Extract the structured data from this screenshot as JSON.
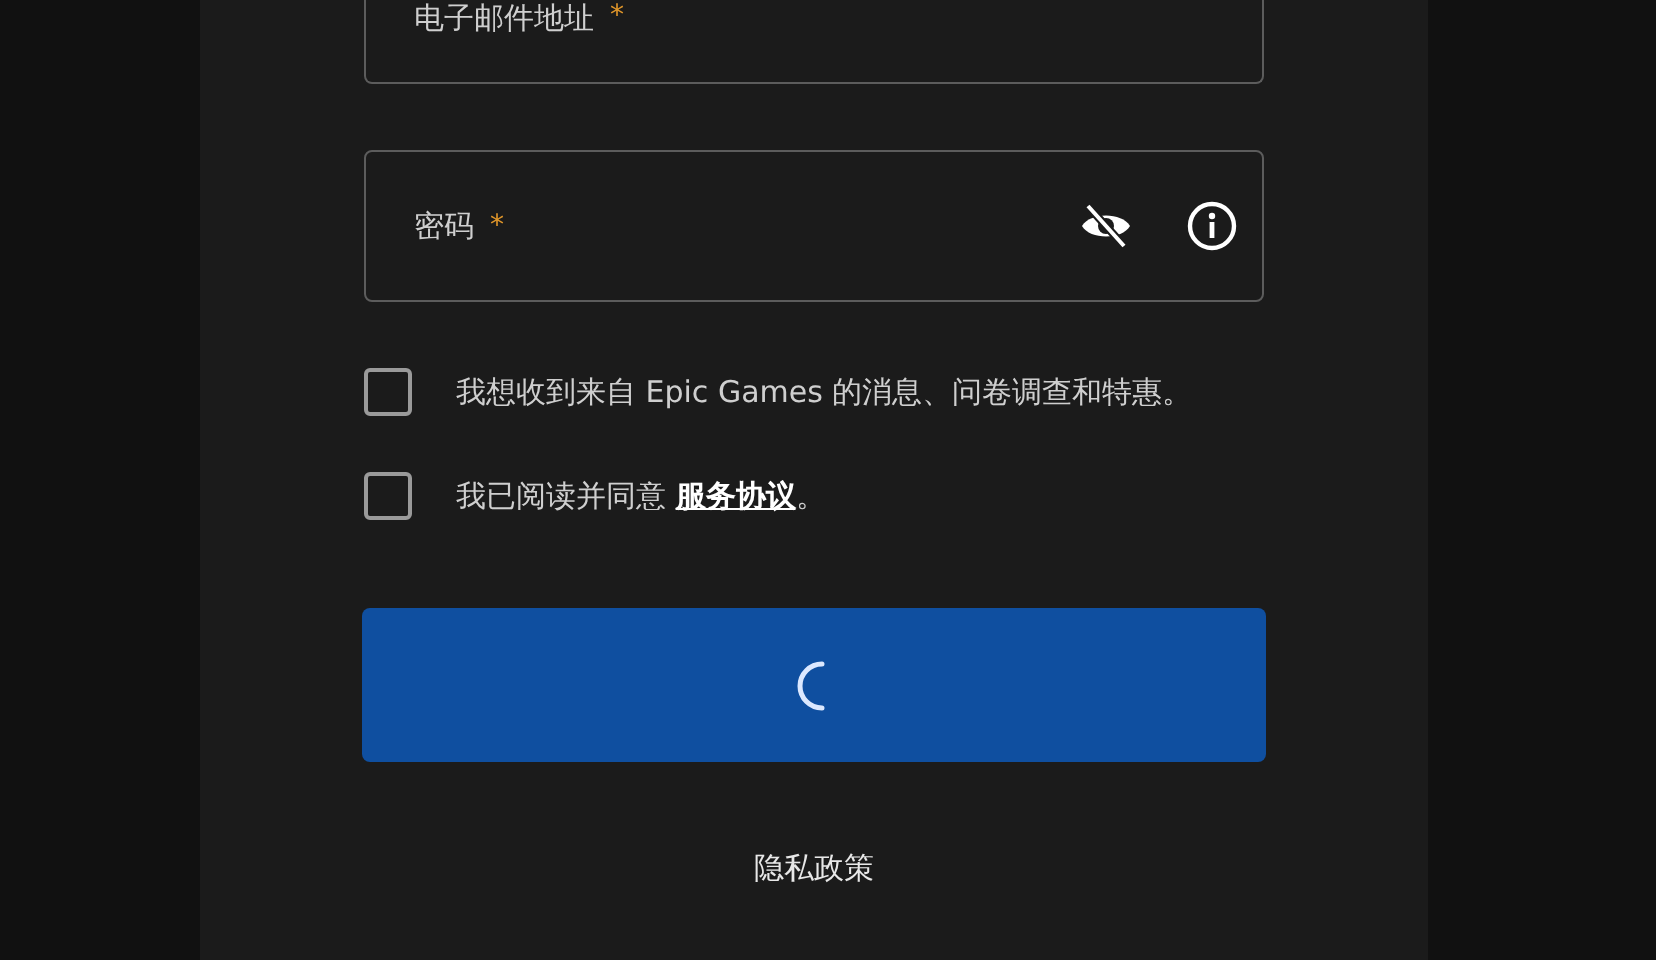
{
  "fields": [
    {
      "kind": "email",
      "label": "电子邮件地址",
      "required_mark": "*"
    },
    {
      "kind": "password",
      "label": "密码",
      "required_mark": "*"
    }
  ],
  "checkboxes": [
    {
      "checked": false,
      "text": "我想收到来自 Epic Games 的消息、问卷调查和特惠。"
    },
    {
      "checked": false,
      "text": "我已阅读并同意 ",
      "link": "服务协议",
      "suffix": "。"
    }
  ],
  "submit_button": {
    "loading": true
  },
  "footer_link": "隐私政策"
}
